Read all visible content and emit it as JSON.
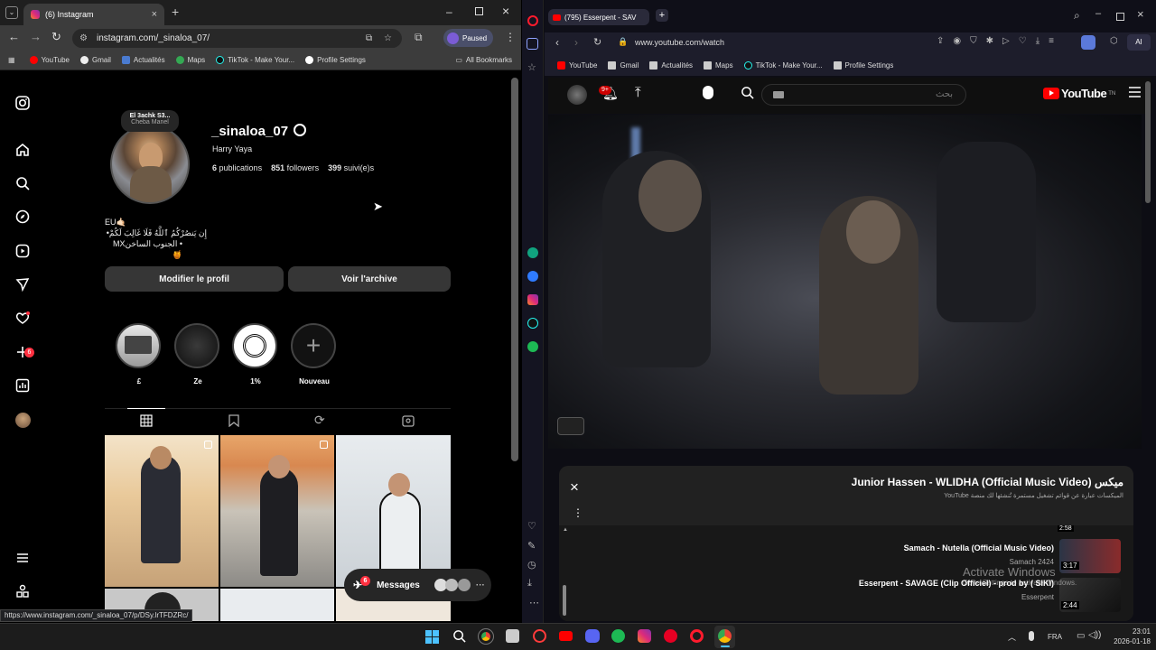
{
  "left_browser": {
    "tab_title": "(6) Instagram",
    "url": "instagram.com/_sinaloa_07/",
    "paused_label": "Paused",
    "bookmarks": [
      "YouTube",
      "Gmail",
      "Actualités",
      "Maps",
      "TikTok - Make Your...",
      "Profile Settings"
    ],
    "all_bookmarks": "All Bookmarks",
    "status_url": "https://www.instagram.com/_sinaloa_07/p/DSy.lrTFDZRc/"
  },
  "instagram": {
    "notif_count": "6",
    "music_note_title": "El 3achk S3...",
    "music_note_artist": "Cheba Manel",
    "username": "_sinaloa_07",
    "full_name": "Harry Yaya",
    "publications_count": "6",
    "publications_label": "publications",
    "followers_count": "851",
    "followers_label": "followers",
    "following_count": "399",
    "following_label": "suivi(e)s",
    "bio_line1": "EU🤙🏻",
    "bio_line2": "إِن يَنصُرْكُمُ ٱللَّهُ فَلَا غَالِبَ لَكُمْ•",
    "bio_line3": "• الجنوب الساخنMX🍯",
    "edit_profile": "Modifier le profil",
    "view_archive": "Voir l'archive",
    "highlights": [
      "£",
      "Ze",
      "1%",
      "Nouveau"
    ],
    "messages_label": "Messages",
    "messages_badge": "6"
  },
  "right_browser": {
    "tab_title": "(795) Esserpent - SAV",
    "url": "www.youtube.com/watch",
    "bookmarks": [
      "YouTube",
      "Gmail",
      "Actualités",
      "Maps",
      "TikTok - Make Your...",
      "Profile Settings"
    ],
    "yt_notif": "9+",
    "search_placeholder": "بحث",
    "logo_text": "YouTube",
    "logo_region": "TN"
  },
  "youtube": {
    "mix_title": "Junior Hassen - WLIDHA (Official Music Video) ميكس",
    "mix_subtitle": "الميكسات عبارة عن قوائم تشغيل مستمرة تُنشئها لك منصة YouTube",
    "partial_duration": "2:58",
    "items": [
      {
        "title": "Samach - Nutella (Official Music Video)",
        "channel": "Samach 2424",
        "duration": "3:17"
      },
      {
        "title": "Esserpent - SAVAGE (Clip Officiel) - prod by ( SIKI)",
        "channel": "Esserpent",
        "duration": "2:44"
      }
    ],
    "watermark_line1": "Activate Windows",
    "watermark_line2": "Go to Settings to activate Windows."
  },
  "taskbar": {
    "lang": "FRA",
    "time": "23:01",
    "date": "2026-01-18"
  },
  "colors": {
    "ig_accent": "#0095f6",
    "yt_red": "#ff0000",
    "opera_red": "#ff1b2d",
    "notif_red": "#ff3040"
  }
}
